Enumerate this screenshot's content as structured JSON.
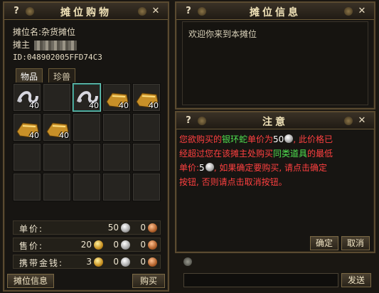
{
  "left_panel": {
    "title": "摊位购物",
    "help": "?",
    "close": "✕",
    "stall_name": "摊位名:杂货摊位",
    "owner_label": "摊主",
    "stall_id": "ID:048902005FFD74C3",
    "tabs": [
      "物品",
      "珍兽"
    ],
    "items": [
      {
        "qty": "40",
        "icon": "silver-snake-icon"
      },
      {
        "qty": "",
        "icon": ""
      },
      {
        "qty": "40",
        "icon": "silver-snake-icon"
      },
      {
        "qty": "40",
        "icon": "gold-ingot-icon"
      },
      {
        "qty": "40",
        "icon": "gold-ingot-icon"
      },
      {
        "qty": "40",
        "icon": "gold-ingot-icon"
      },
      {
        "qty": "40",
        "icon": "gold-ingot-icon"
      }
    ],
    "prices": {
      "unit_label": "单价:",
      "unit_silver": "50",
      "unit_copper": "0",
      "sell_label": "售价:",
      "sell_gold": "20",
      "sell_silver": "0",
      "sell_copper": "0",
      "carry_label": "携带金钱:",
      "carry_gold": "3",
      "carry_silver": "0",
      "carry_copper": "0"
    },
    "stall_info_button": "摊位信息",
    "buy_button": "购买"
  },
  "right_panel": {
    "title": "摊位信息",
    "help": "?",
    "close": "✕",
    "welcome": "欢迎你来到本摊位"
  },
  "notice": {
    "title": "注意",
    "help": "?",
    "close": "✕",
    "line1_a": "您欲购买的",
    "line1_item": "银环蛇",
    "line1_b": "单价为",
    "line1_price": "50",
    "line1_c": ", 此价格已",
    "line2_a": "经超过您在该摊主处购买",
    "line2_item": "同类道具",
    "line2_b": "的最低",
    "line3_a": "单价:",
    "line3_price": "5",
    "line3_b": ", 如果确定要购买, 请点击确定",
    "line4": "按钮, 否则请点击取消按钮。",
    "confirm_button": "确定",
    "cancel_button": "取消"
  },
  "chat": {
    "send_button": "发送"
  },
  "colors": {
    "border": "#5a4a30",
    "warning_red": "#ff4040",
    "highlight_green": "#50e050"
  }
}
